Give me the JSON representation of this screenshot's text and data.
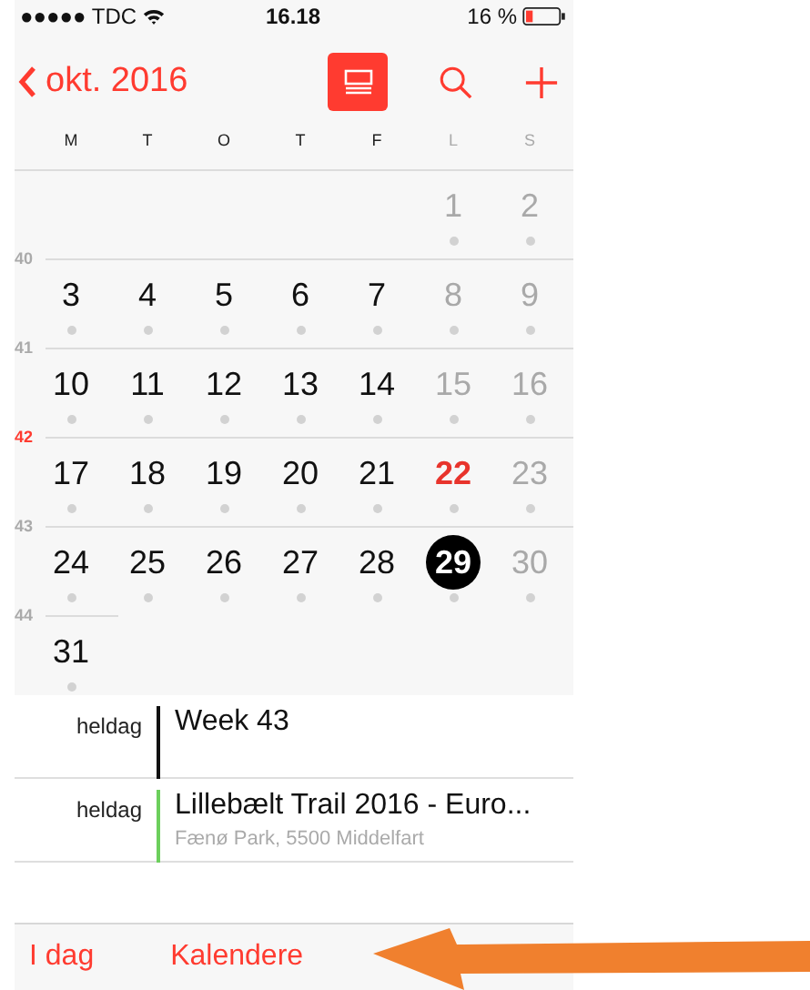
{
  "status_bar": {
    "carrier": "●●●●● TDC",
    "time": "16.18",
    "battery": "16 %"
  },
  "nav": {
    "back": "okt. 2016",
    "list_view_selected": true
  },
  "weekdays": [
    {
      "label": "M",
      "weekend": false
    },
    {
      "label": "T",
      "weekend": false
    },
    {
      "label": "O",
      "weekend": false
    },
    {
      "label": "T",
      "weekend": false
    },
    {
      "label": "F",
      "weekend": false
    },
    {
      "label": "L",
      "weekend": true
    },
    {
      "label": "S",
      "weekend": true
    }
  ],
  "weeks": [
    {
      "days": [
        {
          "label": "1",
          "weekend": true,
          "today": false,
          "selected": false,
          "dot": true
        },
        {
          "label": "2",
          "weekend": true,
          "today": false,
          "selected": false,
          "dot": true
        }
      ]
    },
    {
      "number": "40",
      "current": false,
      "days": [
        {
          "label": "3",
          "weekend": false,
          "today": false,
          "selected": false,
          "dot": true
        },
        {
          "label": "4",
          "weekend": false,
          "today": false,
          "selected": false,
          "dot": true
        },
        {
          "label": "5",
          "weekend": false,
          "today": false,
          "selected": false,
          "dot": true
        },
        {
          "label": "6",
          "weekend": false,
          "today": false,
          "selected": false,
          "dot": true
        },
        {
          "label": "7",
          "weekend": false,
          "today": false,
          "selected": false,
          "dot": true
        },
        {
          "label": "8",
          "weekend": true,
          "today": false,
          "selected": false,
          "dot": true
        },
        {
          "label": "9",
          "weekend": true,
          "today": false,
          "selected": false,
          "dot": true
        }
      ]
    },
    {
      "number": "41",
      "current": false,
      "days": [
        {
          "label": "10",
          "weekend": false,
          "today": false,
          "selected": false,
          "dot": true
        },
        {
          "label": "11",
          "weekend": false,
          "today": false,
          "selected": false,
          "dot": true
        },
        {
          "label": "12",
          "weekend": false,
          "today": false,
          "selected": false,
          "dot": true
        },
        {
          "label": "13",
          "weekend": false,
          "today": false,
          "selected": false,
          "dot": true
        },
        {
          "label": "14",
          "weekend": false,
          "today": false,
          "selected": false,
          "dot": true
        },
        {
          "label": "15",
          "weekend": true,
          "today": false,
          "selected": false,
          "dot": true
        },
        {
          "label": "16",
          "weekend": true,
          "today": false,
          "selected": false,
          "dot": true
        }
      ]
    },
    {
      "number": "42",
      "current": true,
      "days": [
        {
          "label": "17",
          "weekend": false,
          "today": false,
          "selected": false,
          "dot": true
        },
        {
          "label": "18",
          "weekend": false,
          "today": false,
          "selected": false,
          "dot": true
        },
        {
          "label": "19",
          "weekend": false,
          "today": false,
          "selected": false,
          "dot": true
        },
        {
          "label": "20",
          "weekend": false,
          "today": false,
          "selected": false,
          "dot": true
        },
        {
          "label": "21",
          "weekend": false,
          "today": false,
          "selected": false,
          "dot": true
        },
        {
          "label": "22",
          "weekend": true,
          "today": true,
          "selected": false,
          "dot": true
        },
        {
          "label": "23",
          "weekend": true,
          "today": false,
          "selected": false,
          "dot": true
        }
      ]
    },
    {
      "number": "43",
      "current": false,
      "days": [
        {
          "label": "24",
          "weekend": false,
          "today": false,
          "selected": false,
          "dot": true
        },
        {
          "label": "25",
          "weekend": false,
          "today": false,
          "selected": false,
          "dot": true
        },
        {
          "label": "26",
          "weekend": false,
          "today": false,
          "selected": false,
          "dot": true
        },
        {
          "label": "27",
          "weekend": false,
          "today": false,
          "selected": false,
          "dot": true
        },
        {
          "label": "28",
          "weekend": false,
          "today": false,
          "selected": false,
          "dot": true
        },
        {
          "label": "29",
          "weekend": true,
          "today": false,
          "selected": true,
          "dot": true
        },
        {
          "label": "30",
          "weekend": true,
          "today": false,
          "selected": false,
          "dot": true
        }
      ]
    },
    {
      "number": "44",
      "current": false,
      "days": [
        {
          "label": "31",
          "weekend": false,
          "today": false,
          "selected": false,
          "dot": true
        }
      ]
    }
  ],
  "events": [
    {
      "time": "heldag",
      "title": "Week 43",
      "color": "#111111"
    },
    {
      "time": "heldag",
      "title": "Lillebælt Trail 2016 - Euro...",
      "location": "Fænø Park, 5500 Middelfart",
      "color": "#6ccf5c"
    }
  ],
  "tab_bar": [
    "I dag",
    "Kalendere"
  ]
}
